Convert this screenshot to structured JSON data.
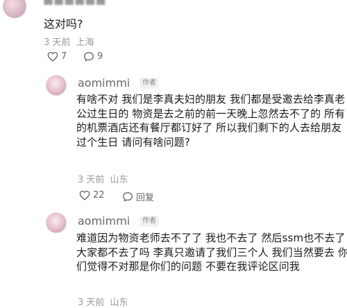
{
  "top_comment": {
    "content": "这对吗?",
    "time": "3 天前",
    "location": "上海",
    "likes": "7",
    "replies": "9"
  },
  "replies": [
    {
      "username": "aomimmi",
      "badge": "作者",
      "content": "有啥不对 我们是李真夫妇的朋友 我们都是受邀去给李真老公过生日的 物资是去之前的前一天晚上忽然去不了的 所有的机票酒店还有餐厅都订好了 所以我们剩下的人去给朋友过个生日 请问有啥问题?",
      "time": "3 天前",
      "location": "山东",
      "likes": "22",
      "reply_label": "回复"
    },
    {
      "username": "aomimmi",
      "badge": "作者",
      "content": "难道因为物资老师去不了了 我也不去了 然后ssm也不去了 大家都不去了吗 李真只邀请了我们三个人 我们当然要去 你们觉得不对那是你们的问题 不要在我评论区问我",
      "time": "3 天前",
      "location": "山东"
    }
  ]
}
